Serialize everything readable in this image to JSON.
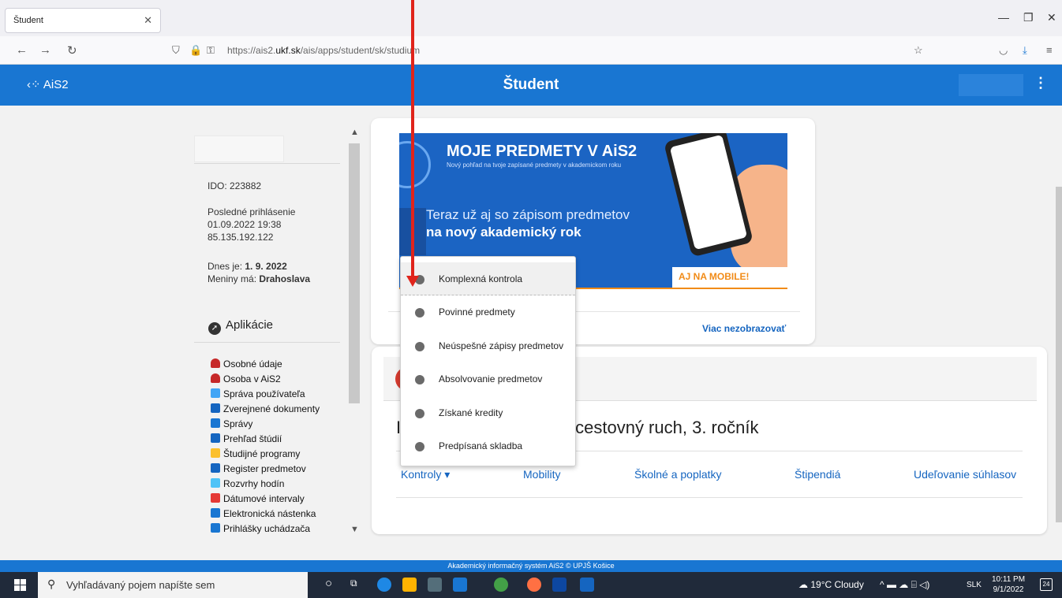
{
  "browser": {
    "tab_title": "Študent",
    "url_prefix": "https://ais2.",
    "url_domain": "ukf.sk",
    "url_path": "/ais/apps/student/sk/studium"
  },
  "app": {
    "logo_text": "AiS2",
    "title": "Študent"
  },
  "sidebar": {
    "ido": "IDO: 223882",
    "last_login_label": "Posledné prihlásenie",
    "last_login_date": "01.09.2022 19:38",
    "last_login_ip": "85.135.192.122",
    "today_label": "Dnes je: ",
    "today_value": "1. 9. 2022",
    "nameday_label": "Meniny má: ",
    "nameday_value": "Drahoslava",
    "apps_title": "Aplikácie",
    "items": [
      {
        "label": "Osobné údaje",
        "color": "#c62828"
      },
      {
        "label": "Osoba v AiS2",
        "color": "#c62828"
      },
      {
        "label": "Správa používateľa",
        "color": "#42a5f5"
      },
      {
        "label": "Zverejnené dokumenty",
        "color": "#1565c0"
      },
      {
        "label": "Správy",
        "color": "#1976d2"
      },
      {
        "label": "Prehľad štúdií",
        "color": "#1565c0"
      },
      {
        "label": "Študijné programy",
        "color": "#fbc02d"
      },
      {
        "label": "Register predmetov",
        "color": "#1565c0"
      },
      {
        "label": "Rozvrhy hodín",
        "color": "#4fc3f7"
      },
      {
        "label": "Dátumové intervaly",
        "color": "#e53935"
      },
      {
        "label": "Elektronická nástenka",
        "color": "#1976d2"
      },
      {
        "label": "Prihlášky uchádzača",
        "color": "#1976d2"
      }
    ]
  },
  "banner": {
    "title": "MOJE PREDMETY V AiS2",
    "subtitle": "Nový pohľad na tvoje zapísané predmety v akademickom roku",
    "line1": "Teraz už aj so zápisom predmetov",
    "line2": "na nový akademický rok",
    "mobile_badge": "AJ NA MOBILE!",
    "dismiss": "Viac nezobrazovať"
  },
  "study": {
    "title_tail": "cestovný ruch, 3. ročník",
    "title_lead": "I",
    "nav": {
      "kontroly": "Kontroly ▾",
      "mobility": "Mobility",
      "skolne": "Školné a poplatky",
      "stipendia": "Štipendiá",
      "suhlasy": "Udeľovanie súhlasov"
    }
  },
  "dropdown": {
    "items": [
      "Komplexná kontrola",
      "Povinné predmety",
      "Neúspešné zápisy predmetov",
      "Absolvovanie predmetov",
      "Získané kredity",
      "Predpísaná skladba"
    ]
  },
  "footer": {
    "text": "Akademický informačný systém AiS2 © UPJŠ Košice"
  },
  "taskbar": {
    "search_placeholder": "Vyhľadávaný pojem napíšte sem",
    "weather": "19°C  Cloudy",
    "lang": "SLK",
    "time": "10:11 PM",
    "date": "9/1/2022",
    "notif_count": "24"
  }
}
